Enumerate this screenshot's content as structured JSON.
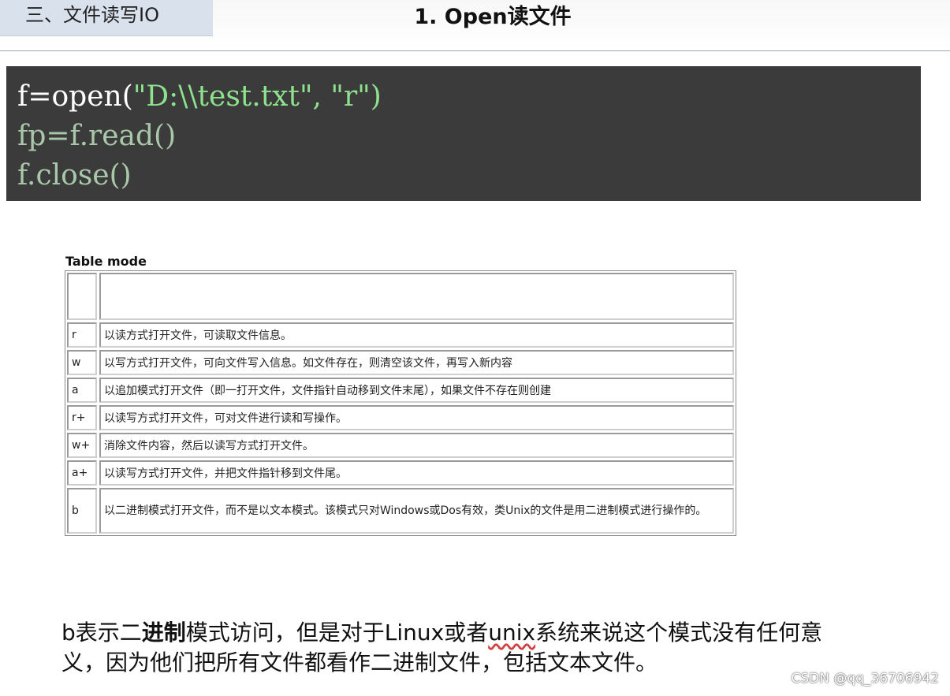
{
  "header": {
    "section_label": "三、文件读写IO",
    "slide_title": "1. Open读文件"
  },
  "code": {
    "line1_name": "f=open(",
    "line1_path": "\"D:\\\\test.txt\"",
    "line1_sep": ", ",
    "line1_mode": "\"r\"",
    "line1_end": ")",
    "line2": "fp=f.read()",
    "line3": "f.close()"
  },
  "table": {
    "caption": "Table mode",
    "header_mode": "",
    "header_desc": "",
    "rows": [
      {
        "mode": "r",
        "desc": "以读方式打开文件，可读取文件信息。"
      },
      {
        "mode": "w",
        "desc": "以写方式打开文件，可向文件写入信息。如文件存在，则清空该文件，再写入新内容"
      },
      {
        "mode": "a",
        "desc": "以追加模式打开文件（即一打开文件，文件指针自动移到文件末尾），如果文件不存在则创建"
      },
      {
        "mode": "r+",
        "desc": "以读写方式打开文件，可对文件进行读和写操作。"
      },
      {
        "mode": "w+",
        "desc": "消除文件内容，然后以读写方式打开文件。"
      },
      {
        "mode": "a+",
        "desc": "以读写方式打开文件，并把文件指针移到文件尾。"
      },
      {
        "mode": "b",
        "desc": "以二进制模式打开文件，而不是以文本模式。该模式只对Windows或Dos有效，类Unix的文件是用二进制模式进行操作的。"
      }
    ]
  },
  "footer": {
    "p1": "b表示二",
    "bold": "进制",
    "p2": "模式访问，但是对于Linux或者",
    "unix": "unix",
    "p3": "系统来说这个模式没有任何意义，因为他们把所有文件都看作二进制文件，包括文本文件。"
  },
  "watermark": "CSDN @qq_36706942"
}
